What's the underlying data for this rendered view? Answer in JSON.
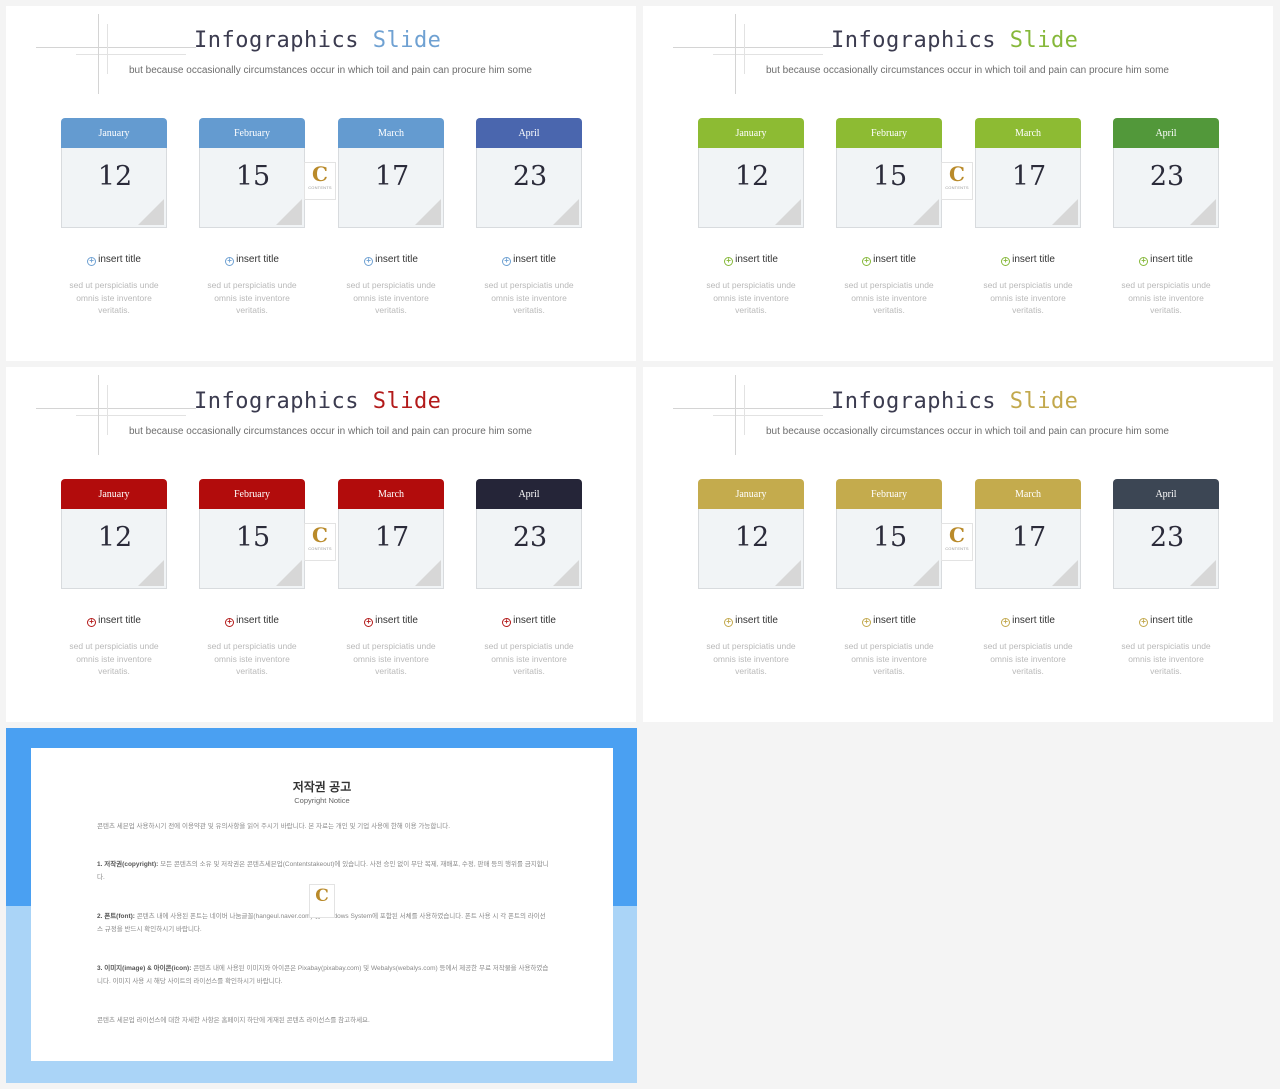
{
  "slides": [
    {
      "title_word1": "Infographics",
      "title_word2": "Slide",
      "subtitle": "but because occasionally circumstances occur in which toil and pain can procure him some",
      "accent": "#6fa1d2",
      "heads": [
        "#649bd0",
        "#649bd0",
        "#649bd0",
        "#4a66ae"
      ],
      "logo": {
        "letter": "C",
        "text": "CONTENTS"
      },
      "cards": [
        {
          "month": "January",
          "day": "12",
          "item_title": "insert title",
          "desc": "sed ut perspiciatis unde omnis iste inventore veritatis."
        },
        {
          "month": "February",
          "day": "15",
          "item_title": "insert title",
          "desc": "sed ut perspiciatis unde omnis iste inventore veritatis."
        },
        {
          "month": "March",
          "day": "17",
          "item_title": "insert title",
          "desc": "sed ut perspiciatis unde omnis iste inventore veritatis."
        },
        {
          "month": "April",
          "day": "23",
          "item_title": "insert title",
          "desc": "sed ut perspiciatis unde omnis iste inventore veritatis."
        }
      ]
    },
    {
      "title_word1": "Infographics",
      "title_word2": "Slide",
      "subtitle": "but because occasionally circumstances occur in which toil and pain can procure him some",
      "accent": "#86b83a",
      "heads": [
        "#8dbb33",
        "#8dbb33",
        "#8dbb33",
        "#52983a"
      ],
      "logo": {
        "letter": "C",
        "text": "CONTENTS"
      },
      "cards": [
        {
          "month": "January",
          "day": "12",
          "item_title": "insert title",
          "desc": "sed ut perspiciatis unde omnis iste inventore veritatis."
        },
        {
          "month": "February",
          "day": "15",
          "item_title": "insert title",
          "desc": "sed ut perspiciatis unde omnis iste inventore veritatis."
        },
        {
          "month": "March",
          "day": "17",
          "item_title": "insert title",
          "desc": "sed ut perspiciatis unde omnis iste inventore veritatis."
        },
        {
          "month": "April",
          "day": "23",
          "item_title": "insert title",
          "desc": "sed ut perspiciatis unde omnis iste inventore veritatis."
        }
      ]
    },
    {
      "title_word1": "Infographics",
      "title_word2": "Slide",
      "subtitle": "but because occasionally circumstances occur in which toil and pain can procure him some",
      "accent": "#b31a1a",
      "heads": [
        "#b20c0c",
        "#b20c0c",
        "#b20c0c",
        "#252538"
      ],
      "logo": {
        "letter": "C",
        "text": "CONTENTS"
      },
      "cards": [
        {
          "month": "January",
          "day": "12",
          "item_title": "insert title",
          "desc": "sed ut perspiciatis unde omnis iste inventore veritatis."
        },
        {
          "month": "February",
          "day": "15",
          "item_title": "insert title",
          "desc": "sed ut perspiciatis unde omnis iste inventore veritatis."
        },
        {
          "month": "March",
          "day": "17",
          "item_title": "insert title",
          "desc": "sed ut perspiciatis unde omnis iste inventore veritatis."
        },
        {
          "month": "April",
          "day": "23",
          "item_title": "insert title",
          "desc": "sed ut perspiciatis unde omnis iste inventore veritatis."
        }
      ]
    },
    {
      "title_word1": "Infographics",
      "title_word2": "Slide",
      "subtitle": "but because occasionally circumstances occur in which toil and pain can procure him some",
      "accent": "#c2a84c",
      "heads": [
        "#c4ab4d",
        "#c4ab4d",
        "#c4ab4d",
        "#3c4654"
      ],
      "logo": {
        "letter": "C",
        "text": "CONTENTS"
      },
      "cards": [
        {
          "month": "January",
          "day": "12",
          "item_title": "insert title",
          "desc": "sed ut perspiciatis unde omnis iste inventore veritatis."
        },
        {
          "month": "February",
          "day": "15",
          "item_title": "insert title",
          "desc": "sed ut perspiciatis unde omnis iste inventore veritatis."
        },
        {
          "month": "March",
          "day": "17",
          "item_title": "insert title",
          "desc": "sed ut perspiciatis unde omnis iste inventore veritatis."
        },
        {
          "month": "April",
          "day": "23",
          "item_title": "insert title",
          "desc": "sed ut perspiciatis unde omnis iste inventore veritatis."
        }
      ]
    }
  ],
  "copyright": {
    "title": "저작권 공고",
    "subtitle": "Copyright Notice",
    "intro": "콘텐츠 세븐업 사용하시기 전에 이용약관 및 유의사항을 읽어 주시기 바랍니다. 본 자료는 개인 및 기업 사용에 한해 이용 가능합니다.",
    "p1_label": "1. 저작권(copyright):",
    "p1": "모든 콘텐츠의 소유 및 저작권은 콘텐츠세븐업(Contentstakeout)에 있습니다. 사전 승인 없이 무단 복제, 재배포, 수정, 판매 등의 행위를 금지합니다.",
    "p2_label": "2. 폰트(font):",
    "p2": "콘텐츠 내에 사용된 폰트는 네이버 나눔글꼴(hangeul.naver.com) 및 Windows System에 포함된 서체를 사용하였습니다. 폰트 사용 시 각 폰트의 라이선스 규정을 반드시 확인하시기 바랍니다.",
    "p3_label": "3. 이미지(image) & 아이콘(icon):",
    "p3": "콘텐츠 내에 사용된 이미지와 아이콘은 Pixabay(pixabay.com) 및 Webalys(webalys.com) 등에서 제공한 무료 저작물을 사용하였습니다. 이미지 사용 시 해당 사이트의 라이선스를 확인하시기 바랍니다.",
    "outro": "콘텐츠 세븐업 라이선스에 대한 자세한 사항은 홈페이지 하단에 게재된 콘텐츠 라이선스를 참고하세요.",
    "logo": {
      "letter": "C"
    },
    "colors": {
      "top": "#4aa0f2",
      "bottom": "#aad4f7"
    }
  }
}
